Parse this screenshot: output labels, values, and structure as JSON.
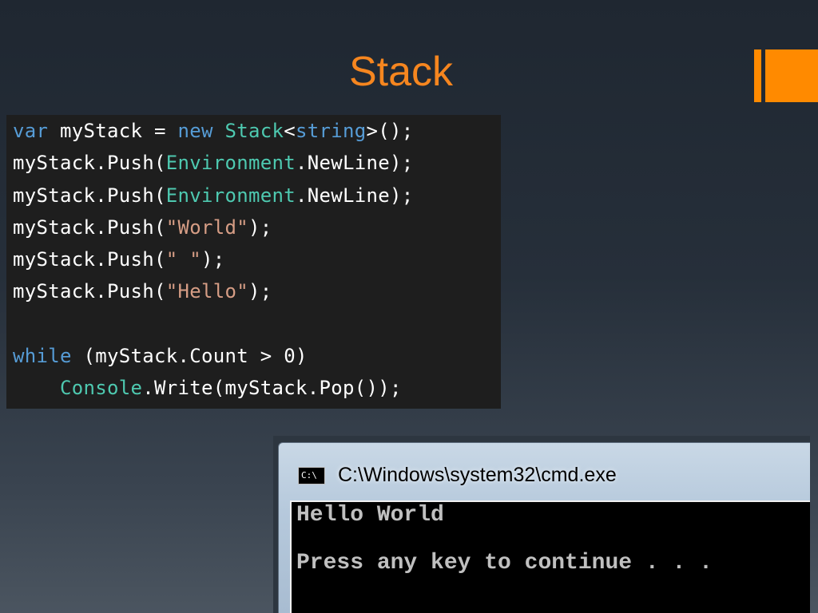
{
  "slide": {
    "title": "Stack",
    "accent_color": "#f6861f"
  },
  "code": {
    "colors": {
      "keyword": "#569cd6",
      "type": "#4ec9b0",
      "string": "#d69d85",
      "plain": "#ffffff",
      "background": "#1e1e1e"
    },
    "lines": [
      [
        {
          "t": "var",
          "c": "kw"
        },
        {
          "t": " myStack = ",
          "c": "pl"
        },
        {
          "t": "new",
          "c": "kw"
        },
        {
          "t": " ",
          "c": "pl"
        },
        {
          "t": "Stack",
          "c": "ty"
        },
        {
          "t": "<",
          "c": "pl"
        },
        {
          "t": "string",
          "c": "kw"
        },
        {
          "t": ">();",
          "c": "pl"
        }
      ],
      [
        {
          "t": "myStack.Push(",
          "c": "pl"
        },
        {
          "t": "Environment",
          "c": "ty"
        },
        {
          "t": ".NewLine);",
          "c": "pl"
        }
      ],
      [
        {
          "t": "myStack.Push(",
          "c": "pl"
        },
        {
          "t": "Environment",
          "c": "ty"
        },
        {
          "t": ".NewLine);",
          "c": "pl"
        }
      ],
      [
        {
          "t": "myStack.Push(",
          "c": "pl"
        },
        {
          "t": "\"World\"",
          "c": "st"
        },
        {
          "t": ");",
          "c": "pl"
        }
      ],
      [
        {
          "t": "myStack.Push(",
          "c": "pl"
        },
        {
          "t": "\" \"",
          "c": "st"
        },
        {
          "t": ");",
          "c": "pl"
        }
      ],
      [
        {
          "t": "myStack.Push(",
          "c": "pl"
        },
        {
          "t": "\"Hello\"",
          "c": "st"
        },
        {
          "t": ");",
          "c": "pl"
        }
      ],
      [],
      [
        {
          "t": "while",
          "c": "kw"
        },
        {
          "t": " (myStack.Count > 0)",
          "c": "pl"
        }
      ],
      [
        {
          "t": "    ",
          "c": "pl"
        },
        {
          "t": "Console",
          "c": "ty"
        },
        {
          "t": ".Write(myStack.Pop());",
          "c": "pl"
        }
      ]
    ]
  },
  "cmd": {
    "title": "C:\\Windows\\system32\\cmd.exe",
    "icon": "cmd-console-icon",
    "icon_label": "C:\\",
    "output_line_1": "Hello World",
    "output_line_2": "Press any key to continue . . ."
  }
}
